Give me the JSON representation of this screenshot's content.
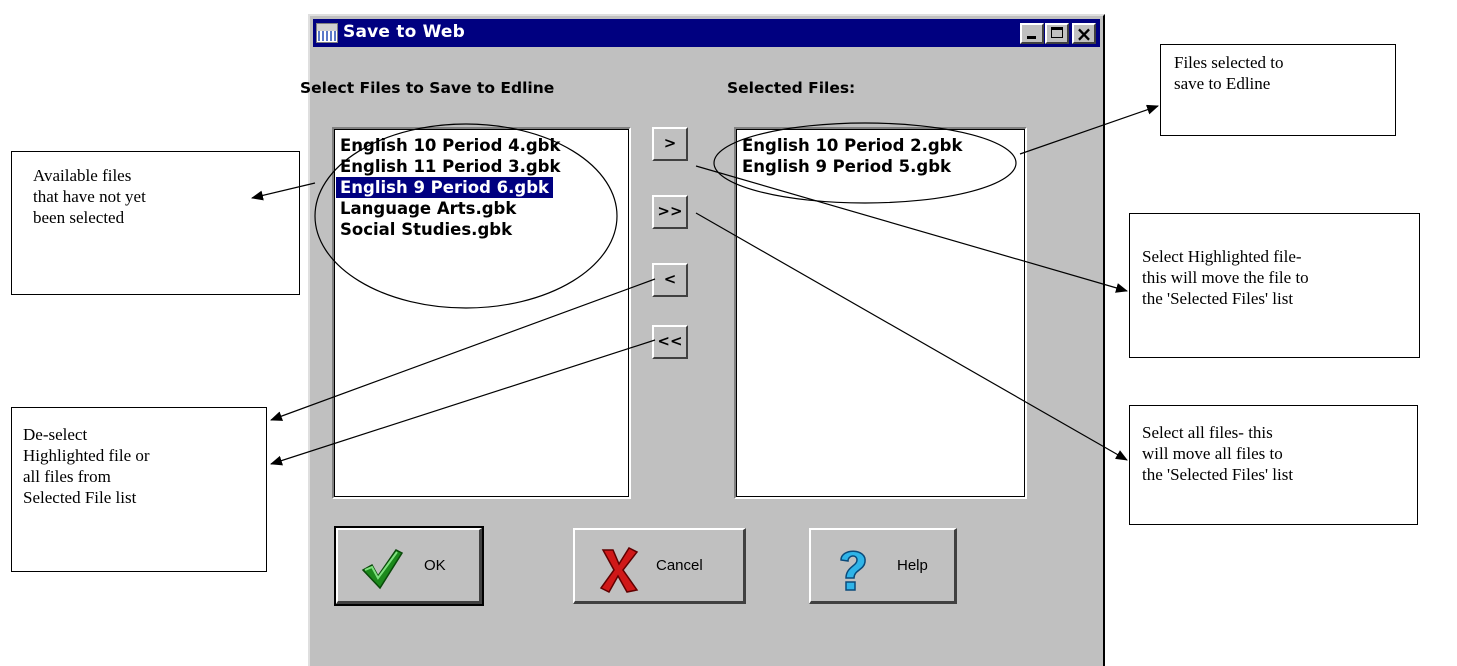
{
  "window": {
    "title": "Save to Web"
  },
  "labels": {
    "available": "Select Files to Save to Edline",
    "selected": "Selected Files:"
  },
  "available_files": [
    "English 10 Period 4.gbk",
    "English 11 Period 3.gbk",
    "English 9 Period 6.gbk",
    "Language Arts.gbk",
    "Social Studies.gbk"
  ],
  "highlighted_file": "English 9 Period 6.gbk",
  "selected_files": [
    "English 10 Period 2.gbk",
    "English 9 Period 5.gbk"
  ],
  "move_buttons": {
    "select_one": ">",
    "select_all": ">>",
    "deselect_one": "<",
    "deselect_all": "<<"
  },
  "buttons": {
    "ok": "OK",
    "cancel": "Cancel",
    "help": "Help"
  },
  "callouts": {
    "available": [
      "Available files",
      "that have not yet",
      "been selected"
    ],
    "files_selected": [
      "Files selected to",
      "save to Edline"
    ],
    "select_highlighted": [
      "Select Highlighted file-",
      "this will move the file to",
      "the 'Selected Files' list"
    ],
    "select_all": [
      "Select all files- this",
      "will move all files to",
      "the 'Selected Files' list"
    ],
    "deselect": [
      "De-select",
      "Highlighted file or",
      "all files from",
      "Selected File list"
    ]
  },
  "colors": {
    "titlebar": "#000080",
    "dialog_face": "#c0c0c0",
    "highlight": "#000080"
  }
}
